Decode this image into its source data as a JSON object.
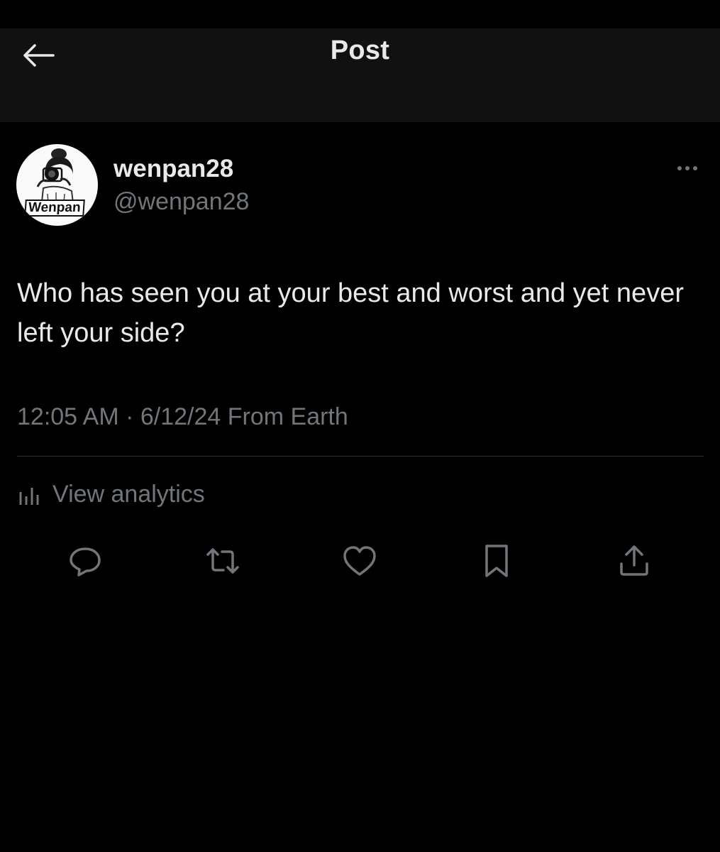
{
  "header": {
    "title": "Post",
    "back_icon": "arrow-left-icon"
  },
  "author": {
    "display_name": "wenpan28",
    "handle": "@wenpan28",
    "avatar_label": "Wenpan"
  },
  "post": {
    "text": "Who has seen you at your best and worst and yet never left your side?",
    "timestamp": "12:05 AM · 6/12/24 From Earth"
  },
  "analytics": {
    "label": "View analytics",
    "icon": "bar-chart-icon"
  },
  "actions": [
    {
      "icon": "reply-icon"
    },
    {
      "icon": "repost-icon"
    },
    {
      "icon": "like-icon"
    },
    {
      "icon": "bookmark-icon"
    },
    {
      "icon": "share-icon"
    }
  ],
  "colors": {
    "background": "#000000",
    "header_bg": "#111111",
    "primary_text": "#e7e9ea",
    "secondary_text": "#71767b",
    "divider": "#2f3336"
  }
}
